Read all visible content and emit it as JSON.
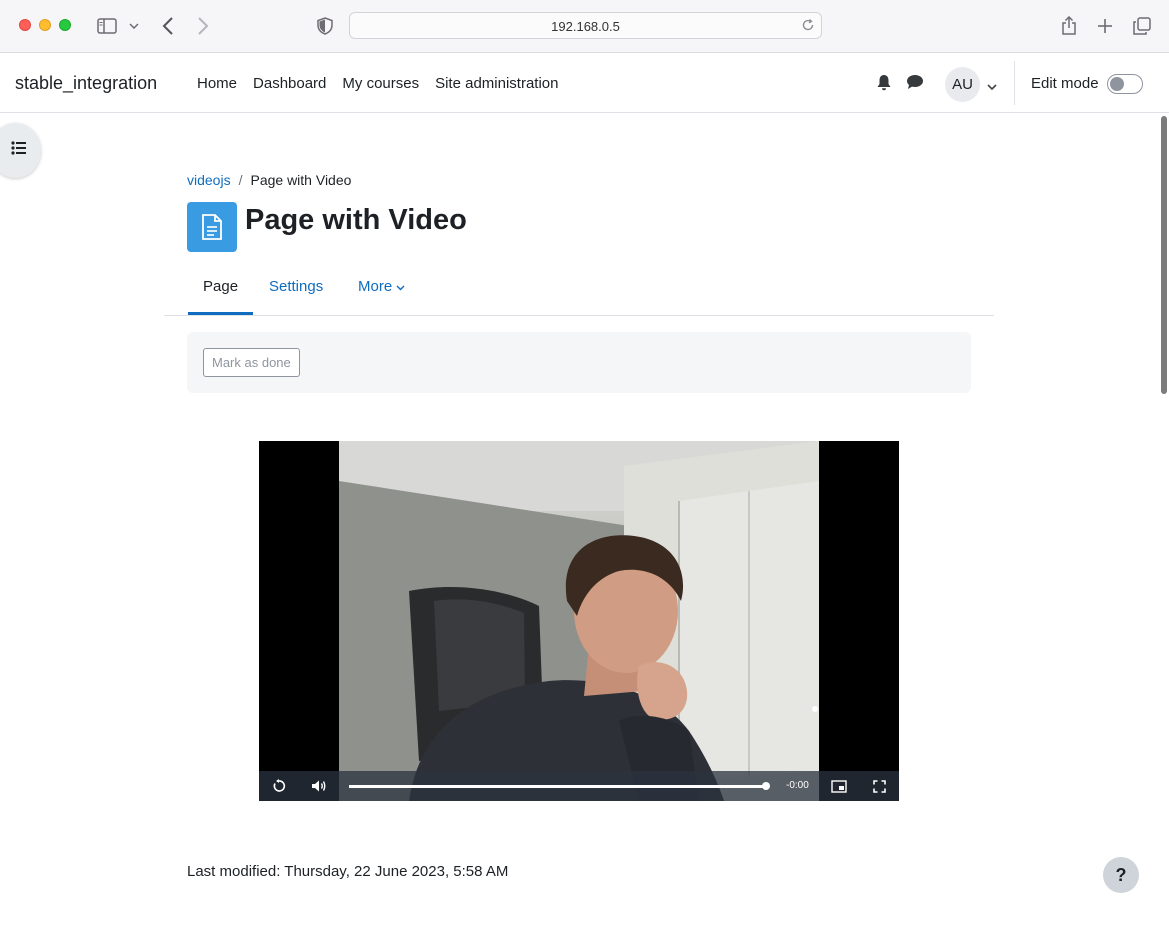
{
  "browser": {
    "url": "192.168.0.5"
  },
  "navbar": {
    "brand": "stable_integration",
    "links": [
      "Home",
      "Dashboard",
      "My courses",
      "Site administration"
    ],
    "avatar_initials": "AU",
    "edit_mode_label": "Edit mode",
    "edit_mode_on": false
  },
  "breadcrumb": {
    "parent": "videojs",
    "separator": "/",
    "current": "Page with Video"
  },
  "page": {
    "title": "Page with Video",
    "icon": "page-icon"
  },
  "tabs": {
    "page": "Page",
    "settings": "Settings",
    "more": "More"
  },
  "activity": {
    "mark_done_label": "Mark as done"
  },
  "video": {
    "remaining_time": "-0:00",
    "progress": 1.0
  },
  "footer": {
    "last_modified": "Last modified: Thursday, 22 June 2023, 5:58 AM"
  },
  "help": {
    "label": "?"
  },
  "colors": {
    "link": "#0f6cbf",
    "page_icon_bg": "#399be2"
  }
}
